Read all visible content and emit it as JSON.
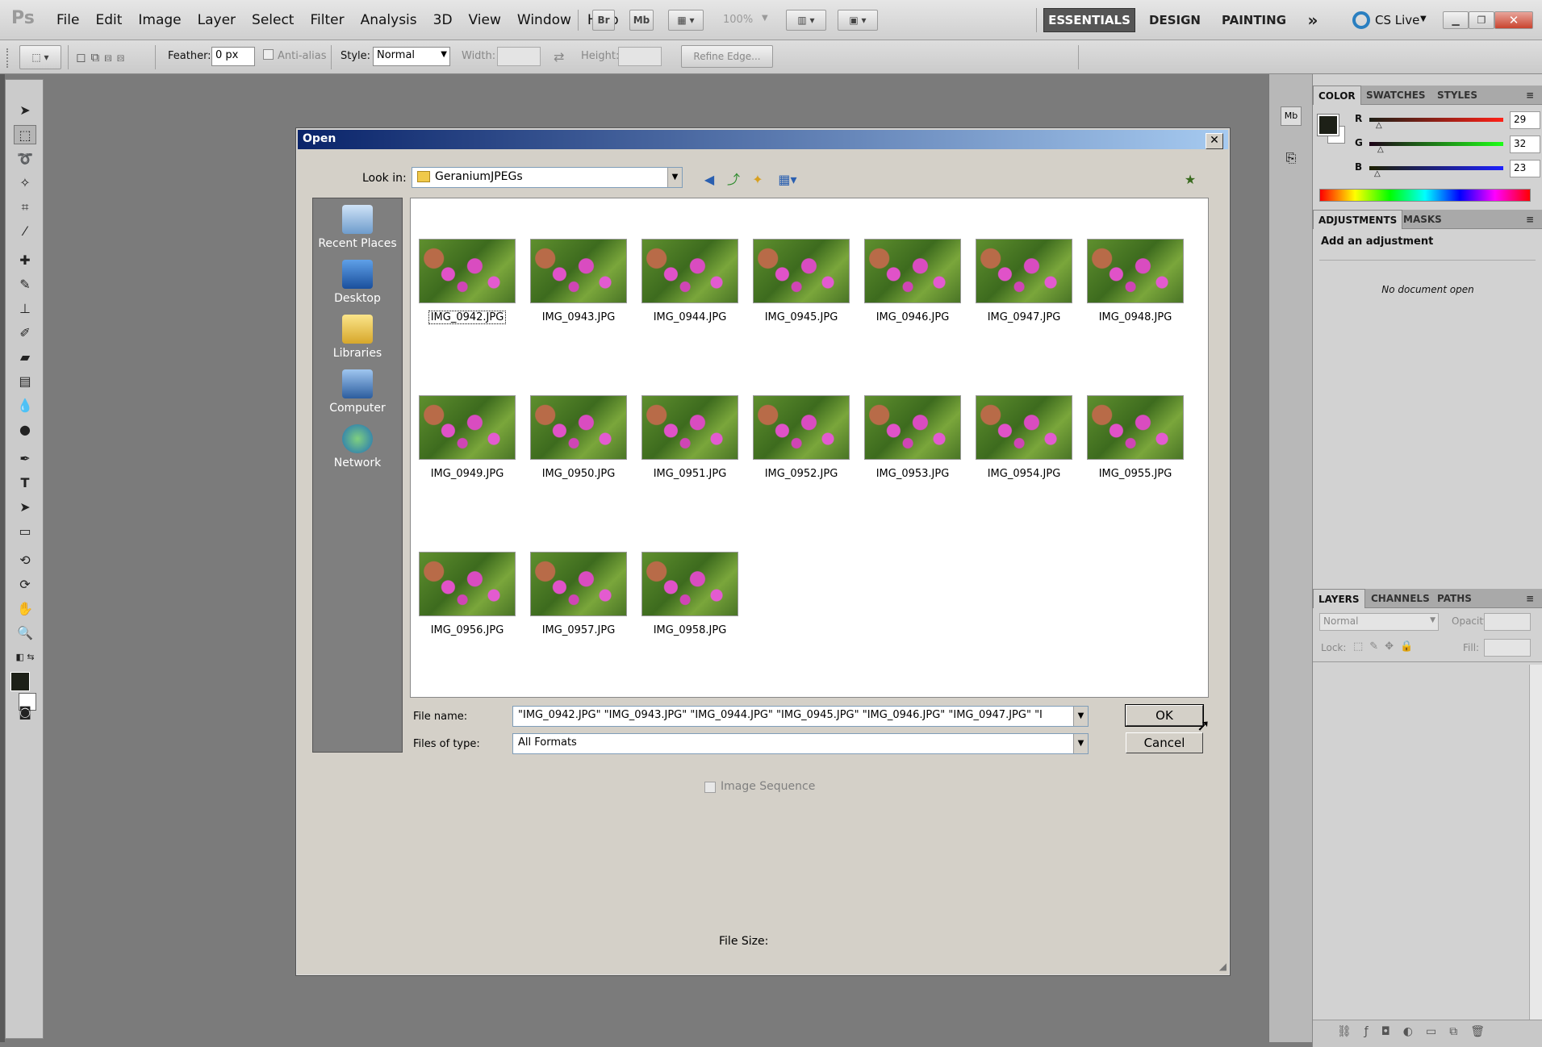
{
  "app": {
    "logo": "Ps"
  },
  "menu": [
    "File",
    "Edit",
    "Image",
    "Layer",
    "Select",
    "Filter",
    "Analysis",
    "3D",
    "View",
    "Window",
    "Help"
  ],
  "appbar": {
    "br": "Br",
    "mb": "Mb",
    "zoom": "100%",
    "workspaces": [
      "ESSENTIALS",
      "DESIGN",
      "PAINTING"
    ],
    "more": "»",
    "cslive": "CS Live"
  },
  "options": {
    "feather_label": "Feather:",
    "feather_value": "0 px",
    "antialias_label": "Anti-alias",
    "style_label": "Style:",
    "style_value": "Normal",
    "width_label": "Width:",
    "height_label": "Height:",
    "refine_edge": "Refine Edge..."
  },
  "color_panel": {
    "tabs": [
      "COLOR",
      "SWATCHES",
      "STYLES"
    ],
    "r_label": "R",
    "g_label": "G",
    "b_label": "B",
    "r": "29",
    "g": "32",
    "b": "23"
  },
  "adjustments_panel": {
    "tabs": [
      "ADJUSTMENTS",
      "MASKS"
    ],
    "heading": "Add an adjustment",
    "empty": "No document open"
  },
  "layers_panel": {
    "tabs": [
      "LAYERS",
      "CHANNELS",
      "PATHS"
    ],
    "blend": "Normal",
    "opacity_label": "Opacity:",
    "lock_label": "Lock:",
    "fill_label": "Fill:"
  },
  "dialog": {
    "title": "Open",
    "look_in_label": "Look in:",
    "look_in_value": "GeraniumJPEGs",
    "places": [
      "Recent Places",
      "Desktop",
      "Libraries",
      "Computer",
      "Network"
    ],
    "files": [
      "IMG_0942.JPG",
      "IMG_0943.JPG",
      "IMG_0944.JPG",
      "IMG_0945.JPG",
      "IMG_0946.JPG",
      "IMG_0947.JPG",
      "IMG_0948.JPG",
      "IMG_0949.JPG",
      "IMG_0950.JPG",
      "IMG_0951.JPG",
      "IMG_0952.JPG",
      "IMG_0953.JPG",
      "IMG_0954.JPG",
      "IMG_0955.JPG",
      "IMG_0956.JPG",
      "IMG_0957.JPG",
      "IMG_0958.JPG"
    ],
    "file_name_label": "File name:",
    "file_name_value": "\"IMG_0942.JPG\" \"IMG_0943.JPG\" \"IMG_0944.JPG\" \"IMG_0945.JPG\" \"IMG_0946.JPG\" \"IMG_0947.JPG\" \"I",
    "files_of_type_label": "Files of type:",
    "files_of_type_value": "All Formats",
    "ok": "OK",
    "cancel": "Cancel",
    "image_sequence": "Image Sequence",
    "file_size_label": "File Size:"
  }
}
